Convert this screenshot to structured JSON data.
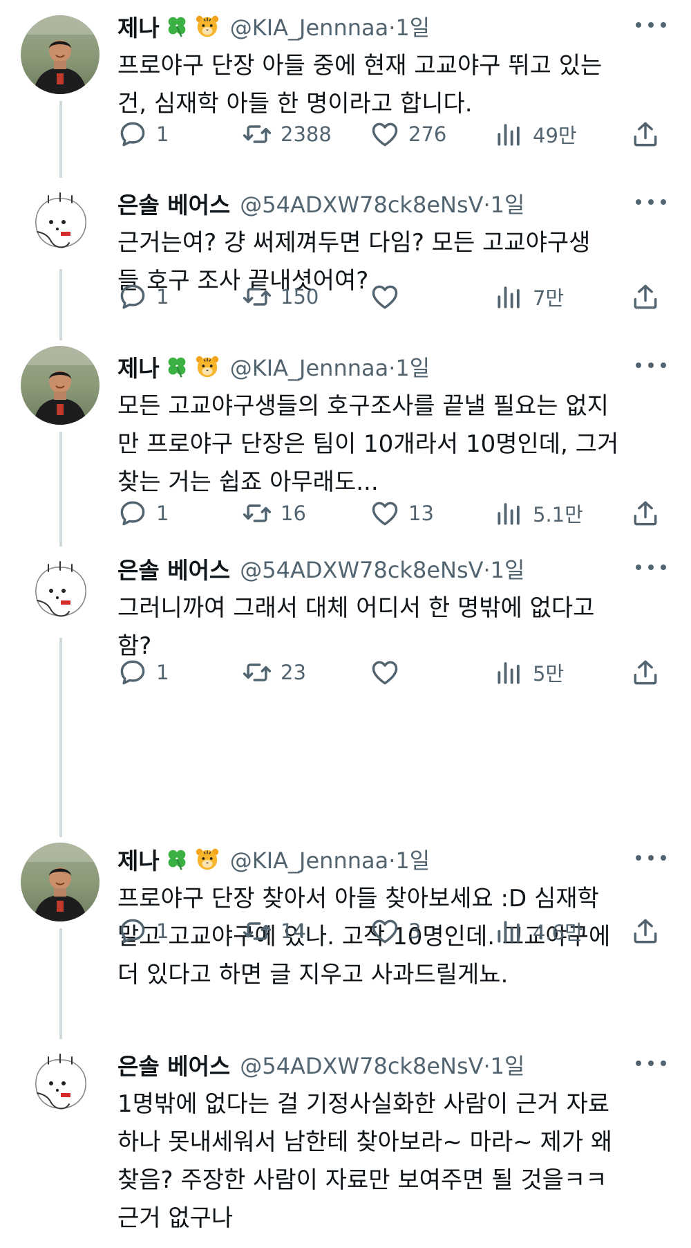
{
  "tweets": [
    {
      "author": "A",
      "name": "제나",
      "handle": "@KIA_Jennnaa",
      "time": "1일",
      "lines": [
        "프로야구 단장 아들 중에 현재 고교야구 뛰고 있는",
        "건, 심재학 아들 한 명이라고 합니다."
      ],
      "reply": "1",
      "retweet": "2388",
      "like": "276",
      "views": "49만"
    },
    {
      "author": "B",
      "name": "은솔 베어스",
      "handle": "@54ADXW78ck8eNsV",
      "time": "1일",
      "lines": [
        "근거는여? 걍 써제껴두면 다임? 모든 고교야구생",
        "들 호구 조사 끝내셧어여?"
      ],
      "reply": "1",
      "retweet": "150",
      "like": "",
      "views": "7만"
    },
    {
      "author": "A",
      "name": "제나",
      "handle": "@KIA_Jennnaa",
      "time": "1일",
      "lines": [
        "모든 고교야구생들의 호구조사를 끝낼 필요는 없지",
        "만 프로야구 단장은 팀이 10개라서 10명인데, 그거",
        "찾는 거는 쉽죠 아무래도..."
      ],
      "reply": "1",
      "retweet": "16",
      "like": "13",
      "views": "5.1만"
    },
    {
      "author": "B",
      "name": "은솔 베어스",
      "handle": "@54ADXW78ck8eNsV",
      "time": "1일",
      "lines": [
        "그러니까여 그래서 대체 어디서 한 명밖에 없다고",
        "함?"
      ],
      "reply": "1",
      "retweet": "23",
      "like": "",
      "views": "5만"
    },
    {
      "author": "A",
      "name": "제나",
      "handle": "@KIA_Jennnaa",
      "time": "1일",
      "lines": [
        "프로야구 단장 찾아서 아들 찾아보세요 :D 심재학",
        "말고 고교야구에 있나. 고작 10명인데. 고교야구에",
        "더 있다고 하면 글 지우고 사과드릴게뇨."
      ],
      "reply": "1",
      "retweet": "14",
      "like": "3",
      "views": "4.6만"
    },
    {
      "author": "B",
      "name": "은솔 베어스",
      "handle": "@54ADXW78ck8eNsV",
      "time": "1일",
      "lines": [
        "1명밖에 없다는 걸 기정사실화한 사람이 근거 자료",
        "하나 못내세워서 남한테 찾아보라~ 마라~ 제가 왜",
        "찾음? 주장한 사람이 자료만 보여주면 될 것을ㅋㅋ",
        "근거 없구나"
      ],
      "reply": "",
      "retweet": "",
      "like": "",
      "views": ""
    }
  ],
  "separator": "·",
  "icons": {
    "more": "more-icon",
    "reply": "reply-icon",
    "retweet": "retweet-icon",
    "like": "like-icon",
    "views": "views-icon",
    "share": "share-icon",
    "clover": "clover-emoji-icon",
    "tiger": "tiger-emoji-icon"
  },
  "colors": {
    "text": "#0f1419",
    "muted": "#536471",
    "thread": "#cfd9de"
  }
}
